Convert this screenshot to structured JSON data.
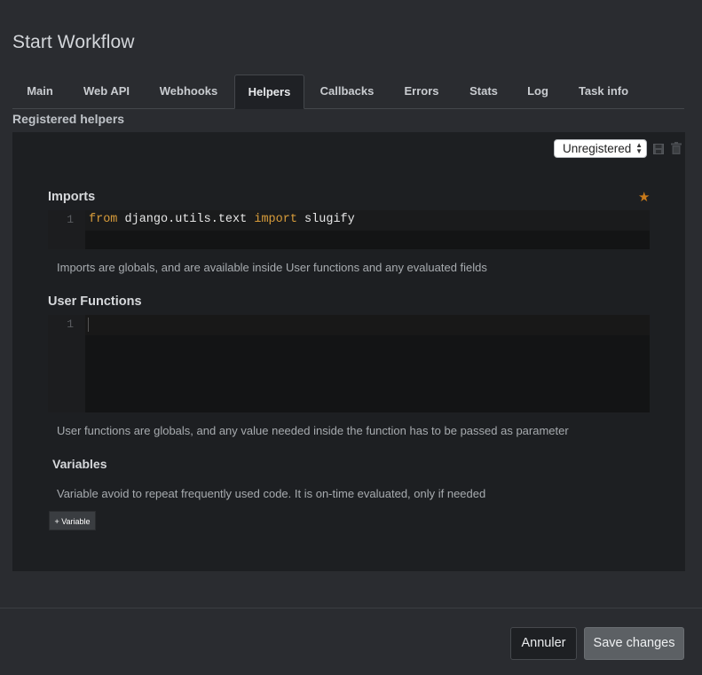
{
  "modal": {
    "title": "Start Workflow"
  },
  "tabs": [
    {
      "label": "Main"
    },
    {
      "label": "Web API"
    },
    {
      "label": "Webhooks"
    },
    {
      "label": "Helpers"
    },
    {
      "label": "Callbacks"
    },
    {
      "label": "Errors"
    },
    {
      "label": "Stats"
    },
    {
      "label": "Log"
    },
    {
      "label": "Task info"
    }
  ],
  "active_tab": "Helpers",
  "helpers": {
    "section_title": "Registered helpers",
    "select_value": "Unregistered",
    "imports": {
      "label": "Imports",
      "line_number": "1",
      "code_tokens": [
        {
          "text": "from",
          "kw": true
        },
        {
          "text": " django.utils.text ",
          "kw": false
        },
        {
          "text": "import",
          "kw": true
        },
        {
          "text": " slugify",
          "kw": false
        }
      ],
      "help": "Imports are globals, and are available inside User functions and any evaluated fields"
    },
    "user_functions": {
      "label": "User Functions",
      "line_number": "1",
      "help": "User functions are globals, and any value needed inside the function has to be passed as parameter"
    },
    "variables": {
      "label": "Variables",
      "help": "Variable avoid to repeat frequently used code. It is on-time evaluated, only if needed",
      "add_button": "+ Variable"
    },
    "star_icon": "star-icon",
    "save_icon": "save-icon",
    "trash_icon": "trash-icon"
  },
  "footer": {
    "cancel_label": "Annuler",
    "save_label": "Save changes"
  },
  "colors": {
    "background": "#2a2c30",
    "panel": "#1d1f22",
    "keyword": "#d89c3a",
    "star": "#c97a1a"
  }
}
